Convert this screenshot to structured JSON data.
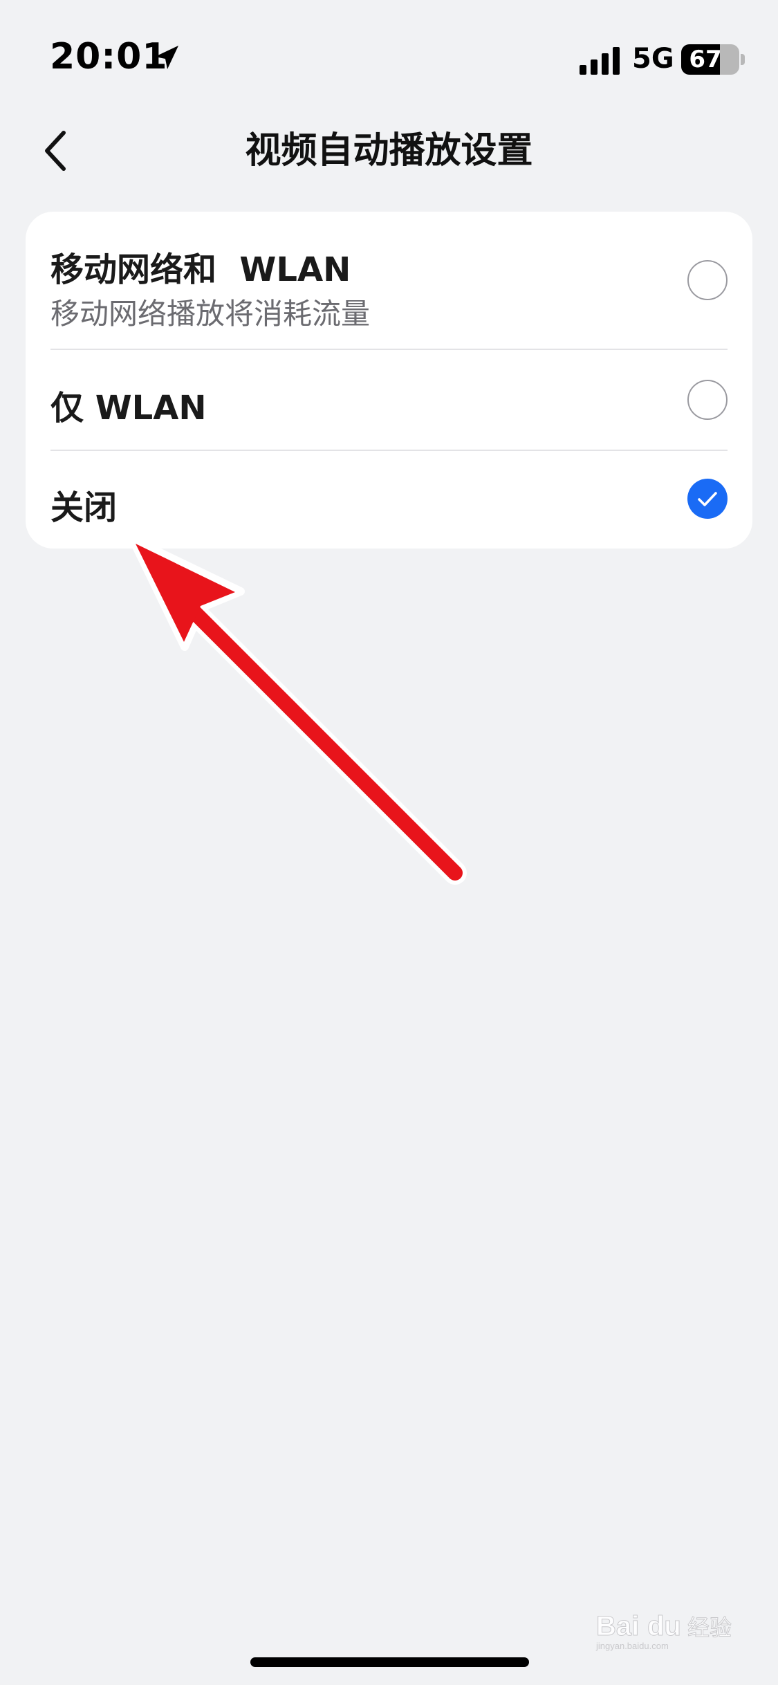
{
  "status_bar": {
    "time": "20:01",
    "network": "5G",
    "battery_level": "67",
    "battery_fraction": 0.67,
    "location_icon": "location-arrow-icon",
    "signal_icon": "cellular-signal-icon"
  },
  "nav": {
    "back_icon": "chevron-left-icon",
    "title": "视频自动播放设置"
  },
  "options": [
    {
      "title": "移动网络和  WLAN",
      "subtitle": "移动网络播放将消耗流量",
      "selected": false
    },
    {
      "title": "仅 WLAN",
      "selected": false
    },
    {
      "title": "关闭",
      "selected": true
    }
  ],
  "colors": {
    "accent": "#1a6bf5",
    "background": "#f1f2f4",
    "card": "#ffffff",
    "annotation_arrow": "#e8141b"
  },
  "watermark": {
    "text_main": "Bai",
    "text_du": "du",
    "text_cn": "经验",
    "text_url": "jingyan.baidu.com"
  }
}
